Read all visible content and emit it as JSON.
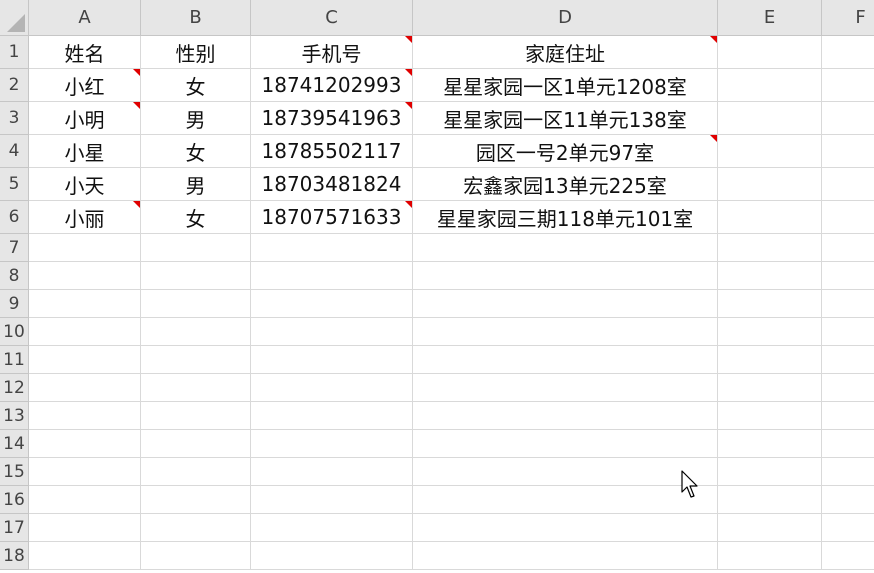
{
  "columns": [
    "A",
    "B",
    "C",
    "D",
    "E",
    "F"
  ],
  "rows": [
    "1",
    "2",
    "3",
    "4",
    "5",
    "6",
    "7",
    "8",
    "9",
    "10",
    "11",
    "12",
    "13",
    "14",
    "15",
    "16",
    "17",
    "18"
  ],
  "cells": [
    [
      "姓名",
      "性别",
      "手机号",
      "家庭住址"
    ],
    [
      "小红",
      "女",
      "18741202993",
      "星星家园一区1单元1208室"
    ],
    [
      "小明",
      "男",
      "18739541963",
      "星星家园一区11单元138室"
    ],
    [
      "小星",
      "女",
      "18785502117",
      "园区一号2单元97室"
    ],
    [
      "小天",
      "男",
      "18703481824",
      "宏鑫家园13单元225室"
    ],
    [
      "小丽",
      "女",
      "18707571633",
      "星星家园三期118单元101室"
    ]
  ],
  "comment_markers": [
    {
      "row": 1,
      "col": 3
    },
    {
      "row": 1,
      "col": 4
    },
    {
      "row": 2,
      "col": 1
    },
    {
      "row": 2,
      "col": 3
    },
    {
      "row": 3,
      "col": 1
    },
    {
      "row": 3,
      "col": 3
    },
    {
      "row": 4,
      "col": 4
    },
    {
      "row": 6,
      "col": 1
    },
    {
      "row": 6,
      "col": 3
    }
  ],
  "colors": {
    "comment_marker": "#e00000",
    "header_bg": "#e6e6e6",
    "gridline": "#d9d9d9"
  },
  "cursor_icon": "mouse-pointer-icon"
}
